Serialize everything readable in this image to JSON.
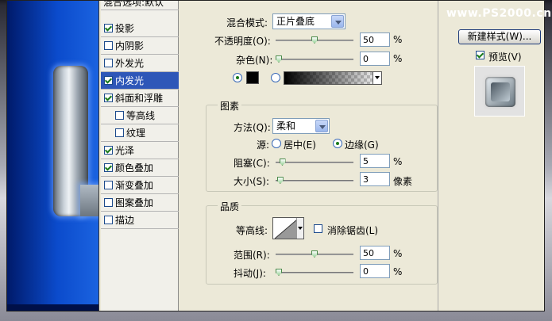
{
  "watermark": "www.PS2000.cn",
  "styles_list": {
    "header": "混合选项:默认",
    "items": [
      {
        "label": "投影",
        "checked": true
      },
      {
        "label": "内阴影",
        "checked": false
      },
      {
        "label": "外发光",
        "checked": false
      },
      {
        "label": "内发光",
        "checked": true,
        "selected": true
      },
      {
        "label": "斜面和浮雕",
        "checked": true
      },
      {
        "label": "等高线",
        "checked": false,
        "sub": true
      },
      {
        "label": "纹理",
        "checked": false,
        "sub": true
      },
      {
        "label": "光泽",
        "checked": true
      },
      {
        "label": "颜色叠加",
        "checked": true
      },
      {
        "label": "渐变叠加",
        "checked": false
      },
      {
        "label": "图案叠加",
        "checked": false
      },
      {
        "label": "描边",
        "checked": false
      }
    ]
  },
  "structure": {
    "blend_mode_label": "混合模式:",
    "blend_mode_value": "正片叠底",
    "opacity_label": "不透明度(O):",
    "opacity_value": "50",
    "opacity_unit": "%",
    "opacity_level": 0.5,
    "noise_label": "杂色(N):",
    "noise_value": "0",
    "noise_unit": "%",
    "noise_level": 0
  },
  "elements": {
    "group_title": "图素",
    "method_label": "方法(Q):",
    "method_value": "柔和",
    "source_label": "源:",
    "source_center_label": "居中(E)",
    "source_edge_label": "边缘(G)",
    "choke_label": "阻塞(C):",
    "choke_value": "5",
    "choke_unit": "%",
    "choke_level": 0.05,
    "size_label": "大小(S):",
    "size_value": "3",
    "size_unit": "像素",
    "size_level": 0.02
  },
  "quality": {
    "group_title": "品质",
    "contour_label": "等高线:",
    "antialias_label": "消除锯齿(L)",
    "range_label": "范围(R):",
    "range_value": "50",
    "range_unit": "%",
    "range_level": 0.5,
    "jitter_label": "抖动(J):",
    "jitter_value": "0",
    "jitter_unit": "%",
    "jitter_level": 0
  },
  "right_panel": {
    "new_style_button": "新建样式(W)...",
    "preview_label": "预览(V)",
    "preview_checked": true
  },
  "colors": {
    "accent": "#2e57b8",
    "glow_color": "#000000"
  }
}
